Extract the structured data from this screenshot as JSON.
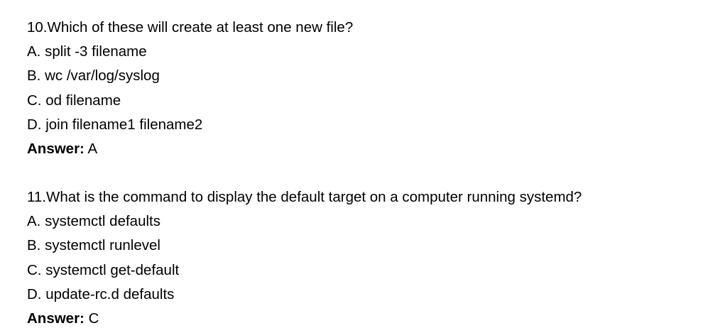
{
  "questions": [
    {
      "prompt": "10.Which of these will create at least one new file?",
      "options": [
        "A. split -3 filename",
        "B. wc /var/log/syslog",
        "C. od filename",
        "D. join filename1 filename2"
      ],
      "answer_label": "Answer:",
      "answer_value": " A"
    },
    {
      "prompt": "11.What is the command to display the default target on a computer running systemd?",
      "options": [
        "A. systemctl defaults",
        "B. systemctl runlevel",
        "C. systemctl get-default",
        "D. update-rc.d defaults"
      ],
      "answer_label": "Answer:",
      "answer_value": " C"
    }
  ]
}
